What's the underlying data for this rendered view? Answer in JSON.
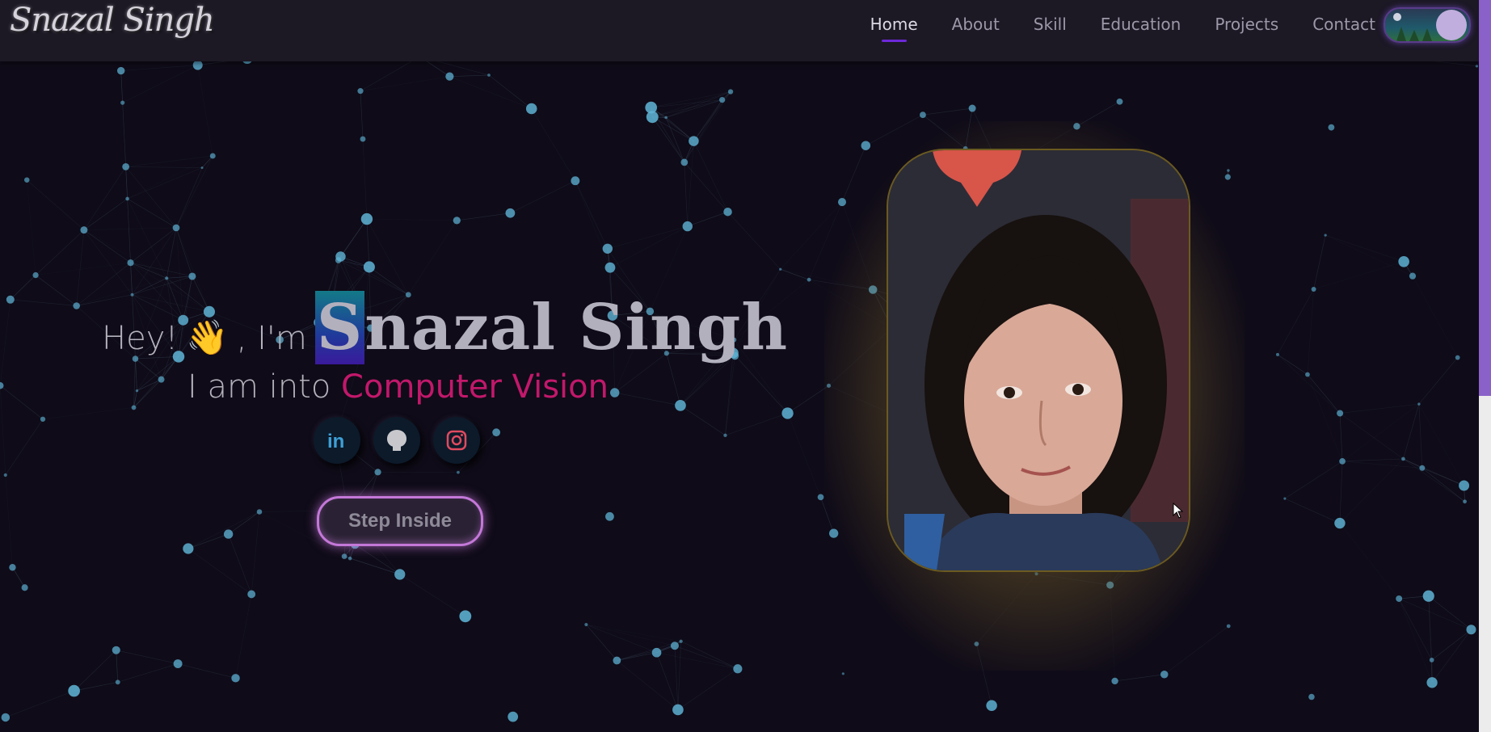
{
  "navbar": {
    "logo": "Snazal Singh",
    "links": [
      "Home",
      "About",
      "Skill",
      "Education",
      "Projects",
      "Contact"
    ],
    "active": "Home"
  },
  "theme_toggle": {
    "state": "dark"
  },
  "hero": {
    "greeting": "Hey!",
    "wave_emoji": "👋",
    "intro": ", I'm",
    "name_first_letter": "S",
    "name_rest": "nazal Singh",
    "subtitle_prefix": "I am into",
    "subtitle_role": "Computer Vision",
    "socials": [
      {
        "name": "linkedin-icon",
        "label": "in"
      },
      {
        "name": "github-icon"
      },
      {
        "name": "instagram-icon"
      }
    ],
    "cta_label": "Step Inside"
  },
  "colors": {
    "background": "#0f0b18",
    "accent": "#6d28d9",
    "role": "#c2186b",
    "nodes": "#5fb4d6"
  }
}
